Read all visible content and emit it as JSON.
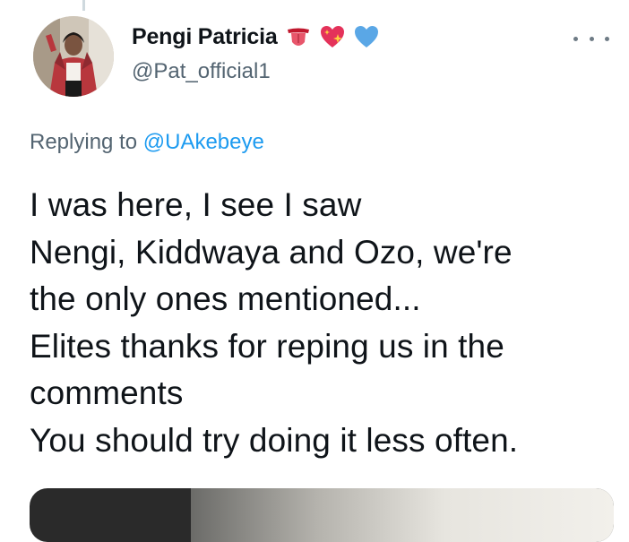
{
  "tweet": {
    "author": {
      "display_name": "Pengi Patricia",
      "handle": "@Pat_official1",
      "name_emojis": [
        "tongue-emoji",
        "sparkling-heart-emoji",
        "blue-heart-emoji"
      ]
    },
    "replying_prefix": "Replying to",
    "replying_to": "@UAkebeye",
    "text_lines": [
      "I was here, I see I saw",
      "Nengi, Kiddwaya and Ozo, we're",
      "the only ones mentioned...",
      "Elites thanks for reping us in the",
      "comments",
      "You should try doing it less often."
    ],
    "more_icon": "more-dots-icon"
  },
  "colors": {
    "text_primary": "#0f1419",
    "text_secondary": "#536471",
    "accent": "#1d9bf0"
  }
}
